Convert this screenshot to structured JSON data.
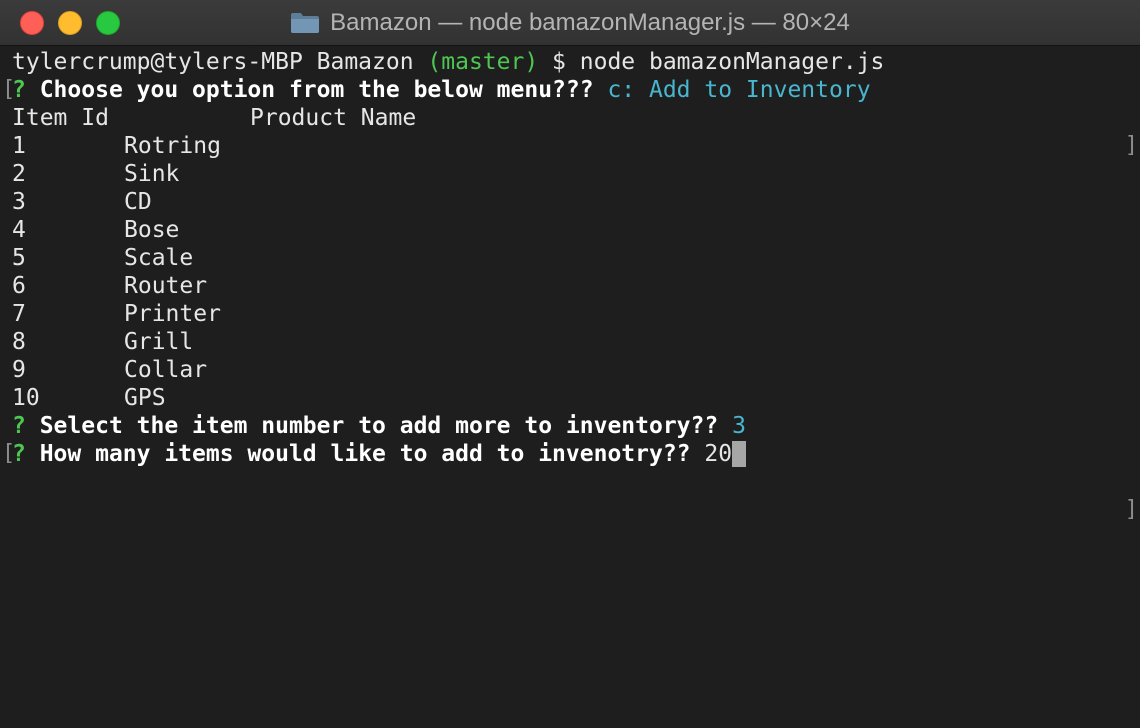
{
  "window": {
    "title": "Bamazon — node bamazonManager.js — 80×24"
  },
  "terminal": {
    "prompt_user": "tylercrump@tylers-MBP Bamazon ",
    "prompt_branch": "(master)",
    "prompt_cmd": " $ node bamazonManager.js",
    "q1_mark": "?",
    "q1_text": " Choose you option from the below menu???",
    "q1_answer": " c: Add to Inventory",
    "table_header": {
      "id": "Item Id",
      "name": "Product Name"
    },
    "items": [
      {
        "id": "1",
        "name": "Rotring"
      },
      {
        "id": "2",
        "name": "Sink"
      },
      {
        "id": "3",
        "name": "CD"
      },
      {
        "id": "4",
        "name": "Bose"
      },
      {
        "id": "5",
        "name": "Scale"
      },
      {
        "id": "6",
        "name": "Router"
      },
      {
        "id": "7",
        "name": "Printer"
      },
      {
        "id": "8",
        "name": "Grill"
      },
      {
        "id": "9",
        "name": "Collar"
      },
      {
        "id": "10",
        "name": "GPS"
      }
    ],
    "q2_mark": "?",
    "q2_text": " Select the item number to add more to inventory??",
    "q2_answer": " 3",
    "q3_mark": "?",
    "q3_text": " How many items would like to add to invenotry??",
    "q3_input": " 20",
    "bracket_open": "[",
    "bracket_close": "]"
  },
  "colors": {
    "background": "#1e1e1e",
    "prompt_green": "#4ec651",
    "answer_cyan": "#49b6cf",
    "text": "#e6e6e6"
  },
  "icons": {
    "title_icon": "folder-icon"
  }
}
